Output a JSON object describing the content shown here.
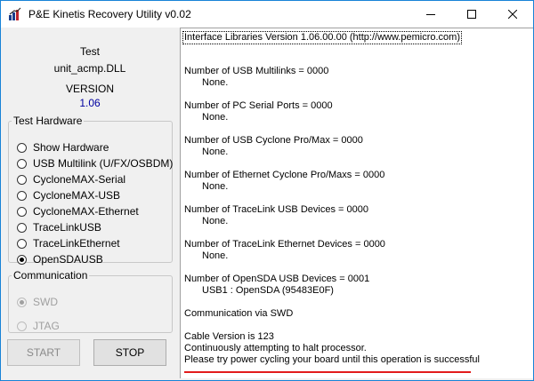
{
  "window": {
    "title": "P&E Kinetis Recovery Utility v0.02",
    "icon": "pe-app-icon",
    "controls": [
      "minimize-icon",
      "maximize-icon",
      "close-icon"
    ]
  },
  "info": {
    "test_label": "Test",
    "dll_name": "unit_acmp.DLL",
    "version_label": "VERSION",
    "version_number": "1.06"
  },
  "hardware": {
    "group_label": "Test Hardware",
    "options": [
      {
        "label": "Show Hardware",
        "checked": false
      },
      {
        "label": "USB Multilink (U/FX/OSBDM)",
        "checked": false
      },
      {
        "label": "CycloneMAX-Serial",
        "checked": false
      },
      {
        "label": "CycloneMAX-USB",
        "checked": false
      },
      {
        "label": "CycloneMAX-Ethernet",
        "checked": false
      },
      {
        "label": "TraceLinkUSB",
        "checked": false
      },
      {
        "label": "TraceLinkEthernet",
        "checked": false
      },
      {
        "label": "OpenSDAUSB",
        "checked": true
      }
    ]
  },
  "communication": {
    "group_label": "Communication",
    "options": [
      {
        "label": "SWD",
        "checked": true,
        "disabled": true
      },
      {
        "label": "JTAG",
        "checked": false,
        "disabled": true
      }
    ]
  },
  "buttons": {
    "start": "START",
    "stop": "STOP"
  },
  "log": {
    "lines": [
      "Interface Libraries Version 1.06.00.00 (http://www.pemicro.com)",
      "Number of USB Multilinks = 0000",
      "None.",
      "Number of PC Serial Ports = 0000",
      "None.",
      "Number of USB Cyclone Pro/Max = 0000",
      "None.",
      "Number of Ethernet Cyclone Pro/Maxs = 0000",
      "None.",
      "Number of TraceLink USB Devices = 0000",
      "None.",
      "Number of TraceLink Ethernet Devices = 0000",
      "None.",
      "Number of OpenSDA USB Devices = 0001",
      "USB1 : OpenSDA (95483E0F)",
      "Communication via SWD",
      "Cable Version is 123",
      "Continuously attempting to halt processor.",
      "Please try power cycling your board until this operation is successful"
    ]
  },
  "colors": {
    "version_number": "#0000a0",
    "window_border": "#1883d7",
    "highlight_underline": "#e21b1b"
  }
}
